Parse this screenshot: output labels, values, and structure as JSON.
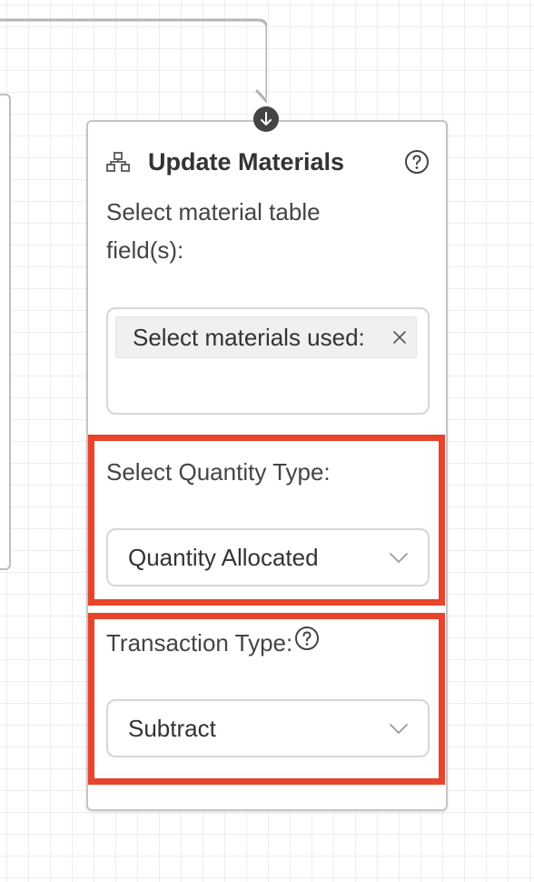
{
  "node": {
    "title": "Update Materials",
    "icon": "hierarchy-icon",
    "help_icon": "question-circle-icon"
  },
  "fields": {
    "materials": {
      "label": "Select material table field(s):",
      "selected_tags": [
        "Select materials used:"
      ]
    },
    "quantity_type": {
      "label": "Select Quantity Type:",
      "value": "Quantity Allocated"
    },
    "transaction_type": {
      "label": "Transaction Type:",
      "value": "Subtract"
    }
  },
  "colors": {
    "highlight": "#e8432b",
    "handle": "#444444",
    "border": "#c4c4c4"
  }
}
